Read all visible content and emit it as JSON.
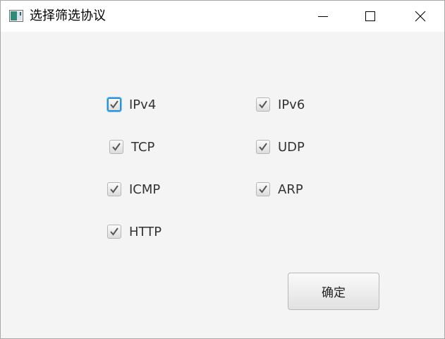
{
  "window": {
    "title": "选择筛选协议",
    "app_icon": "java-window-icon",
    "controls": {
      "minimize_icon": "minimize-icon",
      "maximize_icon": "maximize-icon",
      "close_icon": "close-icon"
    }
  },
  "protocols": [
    {
      "label": "IPv4",
      "checked": true,
      "focused": true
    },
    {
      "label": "IPv6",
      "checked": true
    },
    {
      "label": "TCP",
      "checked": true
    },
    {
      "label": "UDP",
      "checked": true
    },
    {
      "label": "ICMP",
      "checked": true
    },
    {
      "label": "ARP",
      "checked": true
    },
    {
      "label": "HTTP",
      "checked": true
    }
  ],
  "confirm_button": {
    "label": "确定"
  },
  "colors": {
    "focus_ring": "#2a93d5",
    "checkmark": "#555555",
    "background": "#f4f4f4"
  }
}
